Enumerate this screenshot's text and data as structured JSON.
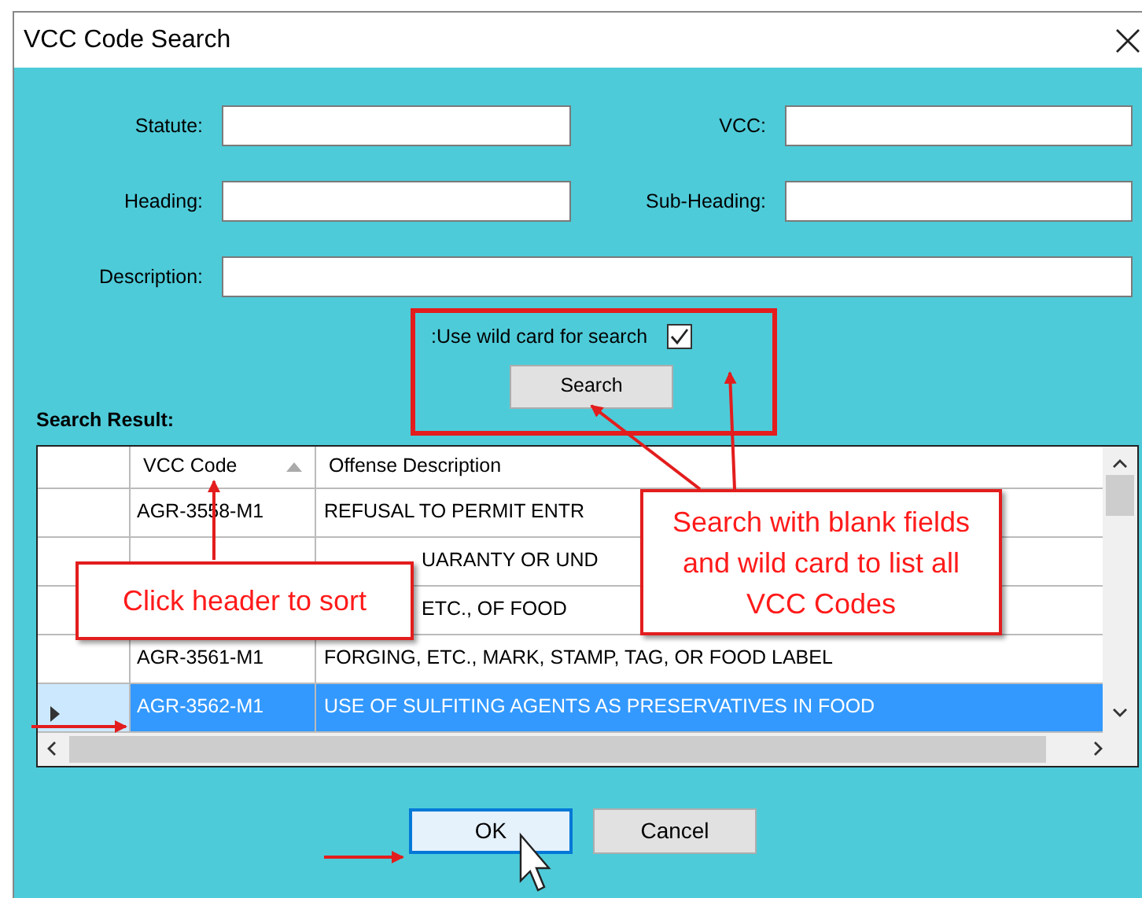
{
  "window": {
    "title": "VCC Code Search"
  },
  "fields": [
    {
      "label": "Statute:",
      "kind": "half"
    },
    {
      "label": "VCC:",
      "kind": "half"
    },
    {
      "label": "Heading:",
      "kind": "half"
    },
    {
      "label": "Sub-Heading:",
      "kind": "half"
    },
    {
      "label": "Description:",
      "kind": "full"
    }
  ],
  "wildcard": {
    "label": ":Use wild card for search",
    "checked": true
  },
  "search_button": "Search",
  "results": {
    "title": "Search Result:",
    "columns": [
      {
        "label": "VCC Code",
        "sorted": true
      },
      {
        "label": "Offense Description",
        "sorted": false
      }
    ],
    "rows": [
      {
        "code": "AGR-3558-M1",
        "description": "REFUSAL TO PERMIT ENTR",
        "selected": false,
        "covered": false
      },
      {
        "description": "UARANTY OR UND",
        "selected": false,
        "covered": true
      },
      {
        "description": "ETC., OF FOOD",
        "selected": false,
        "covered": true
      },
      {
        "code": "AGR-3561-M1",
        "description": "FORGING, ETC., MARK, STAMP, TAG, OR FOOD LABEL",
        "selected": false,
        "covered": false
      },
      {
        "code": "AGR-3562-M1",
        "description": "USE OF SULFITING AGENTS AS PRESERVATIVES IN FOOD",
        "selected": true,
        "covered": false
      }
    ]
  },
  "buttons": [
    {
      "label": "OK",
      "focused": true
    },
    {
      "label": "Cancel",
      "focused": false
    }
  ],
  "callouts": [
    {
      "text": "Click header to sort",
      "kind": "sort"
    },
    {
      "text": "Search with blank fields and wild card to list all VCC Codes",
      "kind": "search"
    }
  ]
}
